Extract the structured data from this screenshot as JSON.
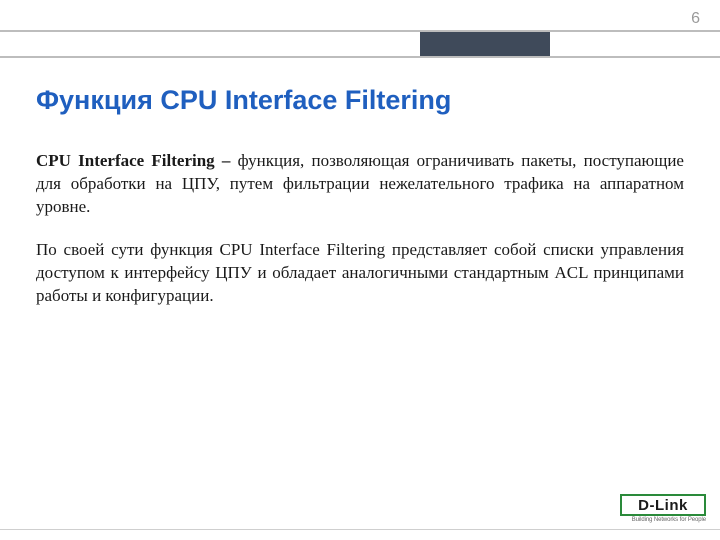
{
  "page_number": "6",
  "title": "Функция CPU Interface Filtering",
  "paragraph1": {
    "lead": "CPU Interface Filtering – ",
    "rest": "функция, позволяющая ограничивать пакеты, поступающие для обработки на ЦПУ, путем фильтрации нежелательного трафика на аппаратном уровне."
  },
  "paragraph2": "По своей сути функция CPU Interface Filtering представляет собой списки управления доступом к интерфейсу ЦПУ и обладает аналогичными стандартным ACL принципами работы и конфигурации.",
  "logo": {
    "brand": "D-Link",
    "tagline": "Building Networks for People"
  }
}
